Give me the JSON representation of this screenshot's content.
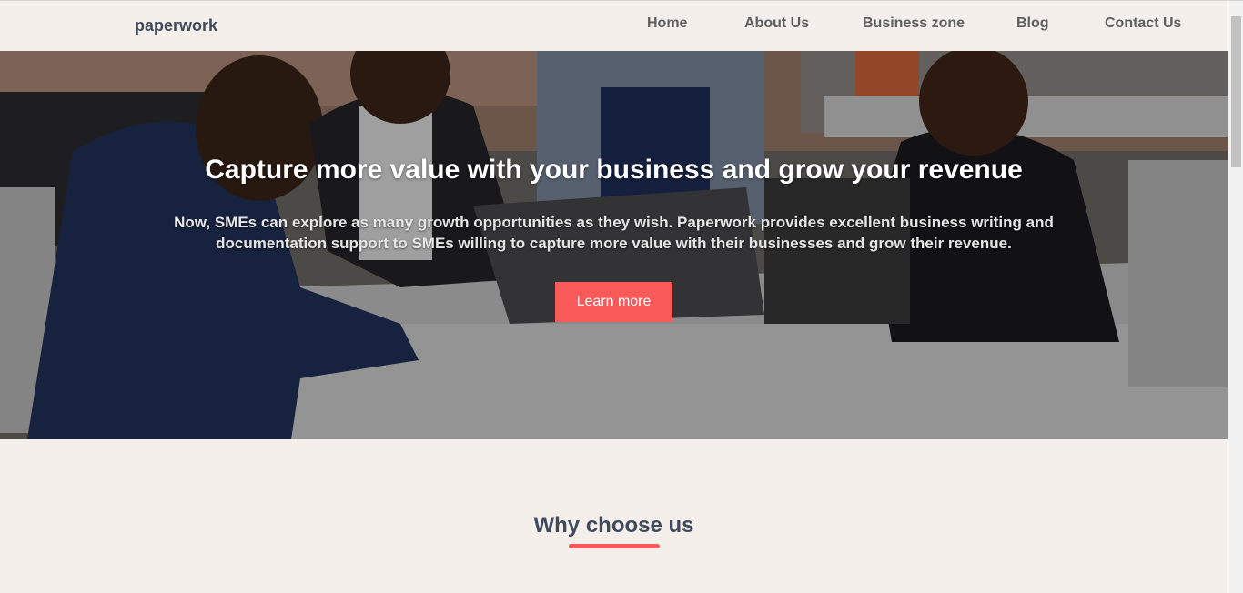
{
  "brand": "paperwork",
  "nav": {
    "home": "Home",
    "about": "About Us",
    "business": "Business zone",
    "blog": "Blog",
    "contact": "Contact Us"
  },
  "hero": {
    "title": "Capture more value with your business and grow your revenue",
    "subtitle": "Now, SMEs can explore as many growth opportunities as they wish. Paperwork provides excellent business writing and documentation support to SMEs willing to capture more value with their businesses and grow their revenue.",
    "cta": "Learn more"
  },
  "why": {
    "title": "Why choose us"
  },
  "colors": {
    "accent": "#f85a5a",
    "background": "#f4efea",
    "heading": "#3e4a5c"
  }
}
